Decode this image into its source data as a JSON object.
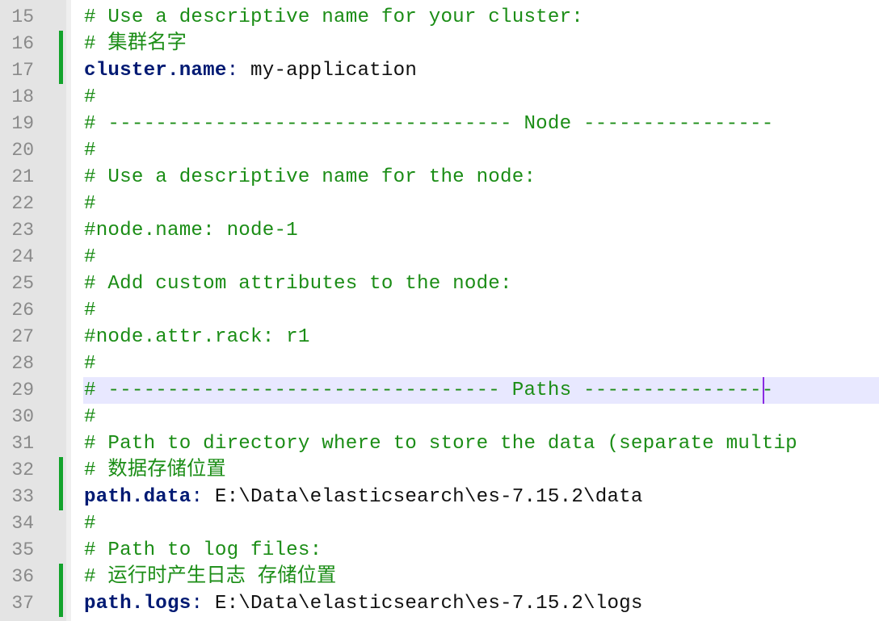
{
  "editor": {
    "lines": [
      {
        "number": "15",
        "changed": false,
        "current": false,
        "tokens": [
          {
            "type": "comment",
            "text": "# Use a descriptive name for your cluster:"
          }
        ]
      },
      {
        "number": "16",
        "changed": true,
        "current": false,
        "tokens": [
          {
            "type": "comment",
            "text": "# 集群名字"
          }
        ]
      },
      {
        "number": "17",
        "changed": true,
        "current": false,
        "tokens": [
          {
            "type": "key",
            "text": "cluster.name"
          },
          {
            "type": "colon",
            "text": ": "
          },
          {
            "type": "value",
            "text": "my-application"
          }
        ]
      },
      {
        "number": "18",
        "changed": false,
        "current": false,
        "tokens": [
          {
            "type": "comment",
            "text": "#"
          }
        ]
      },
      {
        "number": "19",
        "changed": false,
        "current": false,
        "tokens": [
          {
            "type": "comment",
            "text": "# ---------------------------------- Node ----------------"
          }
        ]
      },
      {
        "number": "20",
        "changed": false,
        "current": false,
        "tokens": [
          {
            "type": "comment",
            "text": "#"
          }
        ]
      },
      {
        "number": "21",
        "changed": false,
        "current": false,
        "tokens": [
          {
            "type": "comment",
            "text": "# Use a descriptive name for the node:"
          }
        ]
      },
      {
        "number": "22",
        "changed": false,
        "current": false,
        "tokens": [
          {
            "type": "comment",
            "text": "#"
          }
        ]
      },
      {
        "number": "23",
        "changed": false,
        "current": false,
        "tokens": [
          {
            "type": "comment",
            "text": "#node.name: node-1"
          }
        ]
      },
      {
        "number": "24",
        "changed": false,
        "current": false,
        "tokens": [
          {
            "type": "comment",
            "text": "#"
          }
        ]
      },
      {
        "number": "25",
        "changed": false,
        "current": false,
        "tokens": [
          {
            "type": "comment",
            "text": "# Add custom attributes to the node:"
          }
        ]
      },
      {
        "number": "26",
        "changed": false,
        "current": false,
        "tokens": [
          {
            "type": "comment",
            "text": "#"
          }
        ]
      },
      {
        "number": "27",
        "changed": false,
        "current": false,
        "tokens": [
          {
            "type": "comment",
            "text": "#node.attr.rack: r1"
          }
        ]
      },
      {
        "number": "28",
        "changed": false,
        "current": false,
        "tokens": [
          {
            "type": "comment",
            "text": "#"
          }
        ]
      },
      {
        "number": "29",
        "changed": false,
        "current": true,
        "tokens": [
          {
            "type": "comment",
            "text": "# --------------------------------- Paths ----------------"
          }
        ]
      },
      {
        "number": "30",
        "changed": false,
        "current": false,
        "tokens": [
          {
            "type": "comment",
            "text": "#"
          }
        ]
      },
      {
        "number": "31",
        "changed": false,
        "current": false,
        "tokens": [
          {
            "type": "comment",
            "text": "# Path to directory where to store the data (separate multip"
          }
        ]
      },
      {
        "number": "32",
        "changed": true,
        "current": false,
        "tokens": [
          {
            "type": "comment",
            "text": "# 数据存储位置"
          }
        ]
      },
      {
        "number": "33",
        "changed": true,
        "current": false,
        "tokens": [
          {
            "type": "key",
            "text": "path.data"
          },
          {
            "type": "colon",
            "text": ": "
          },
          {
            "type": "value",
            "text": "E:\\Data\\elasticsearch\\es-7.15.2\\data"
          }
        ]
      },
      {
        "number": "34",
        "changed": false,
        "current": false,
        "tokens": [
          {
            "type": "comment",
            "text": "#"
          }
        ]
      },
      {
        "number": "35",
        "changed": false,
        "current": false,
        "tokens": [
          {
            "type": "comment",
            "text": "# Path to log files:"
          }
        ]
      },
      {
        "number": "36",
        "changed": true,
        "current": false,
        "tokens": [
          {
            "type": "comment",
            "text": "# 运行时产生日志 存储位置"
          }
        ]
      },
      {
        "number": "37",
        "changed": true,
        "current": false,
        "tokens": [
          {
            "type": "key",
            "text": "path.logs"
          },
          {
            "type": "colon",
            "text": ": "
          },
          {
            "type": "value",
            "text": "E:\\Data\\elasticsearch\\es-7.15.2\\logs"
          }
        ]
      }
    ]
  },
  "colors": {
    "gutter_bg": "#e4e4e4",
    "line_number": "#8a8a8a",
    "change_marker": "#12a32b",
    "comment": "#1b8d16",
    "key": "#001a73",
    "value": "#111111",
    "current_line_bg": "#e8e8ff",
    "caret": "#8a2be2"
  }
}
